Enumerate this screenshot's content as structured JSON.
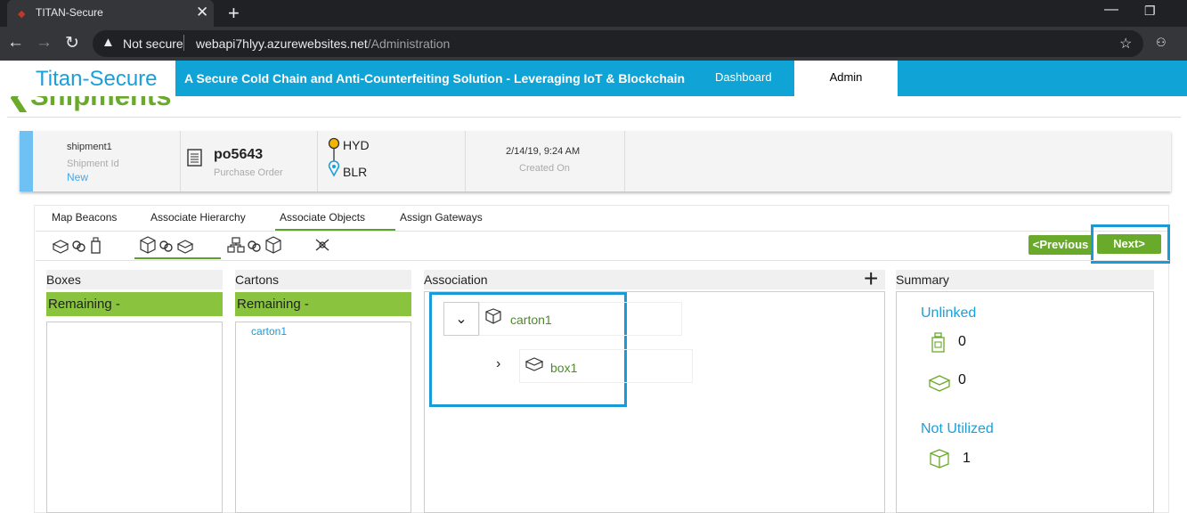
{
  "browser": {
    "tab_title": "TITAN-Secure",
    "not_secure": "Not secure",
    "url_host": "webapi7hlyy.azurewebsites.net",
    "url_path": "/Administration"
  },
  "header": {
    "brand": "Titan-Secure",
    "tagline": "A Secure Cold Chain and Anti-Counterfeiting Solution - Leveraging IoT & Blockchain",
    "nav": [
      "Dashboard",
      "Admin"
    ],
    "accent_color": "#0fa3d6"
  },
  "page_title": "Shipments",
  "shipment": {
    "name": "shipment1",
    "id_label": "Shipment Id",
    "status": "New",
    "po": "po5643",
    "po_label": "Purchase Order",
    "origin": "HYD",
    "destination": "BLR",
    "created": "2/14/19, 9:24 AM",
    "created_label": "Created On"
  },
  "tabs": [
    "Map Beacons",
    "Associate Hierarchy",
    "Associate Objects",
    "Assign Gateways"
  ],
  "buttons": {
    "previous": "<Previous",
    "next": "Next>"
  },
  "columns": {
    "boxes": {
      "title": "Boxes",
      "remaining": "Remaining -"
    },
    "cartons": {
      "title": "Cartons",
      "remaining": "Remaining -",
      "items": [
        "carton1"
      ]
    },
    "association": {
      "title": "Association",
      "carton": "carton1",
      "box": "box1"
    },
    "summary": {
      "title": "Summary",
      "unlinked": "Unlinked",
      "unlinked_bottles": "0",
      "unlinked_boxes": "0",
      "not_utilized": "Not Utilized",
      "not_utilized_cartons": "1"
    }
  }
}
